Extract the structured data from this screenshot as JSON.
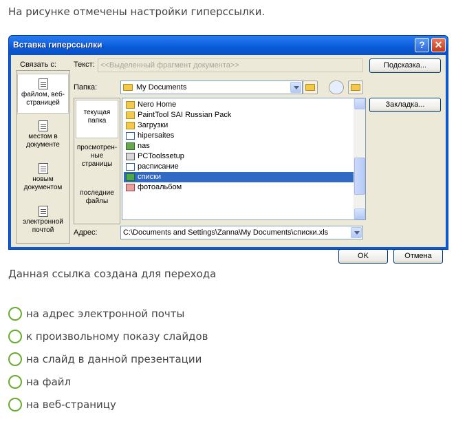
{
  "intro_text": "На рисунке отмечены настройки гиперссылки.",
  "dialog": {
    "title": "Вставка гиперссылки",
    "help_glyph": "?",
    "close_glyph": "✕",
    "link_to_label": "Связать с:",
    "text_label": "Текст:",
    "text_value": "<<Выделенный фрагмент документа>>",
    "tooltip_button": "Подсказка...",
    "folder_label": "Папка:",
    "folder_value": "My Documents",
    "bookmark_button": "Закладка...",
    "address_label": "Адрес:",
    "address_value": "C:\\Documents and Settings\\Zanna\\My Documents\\списки.xls",
    "ok_button": "OK",
    "cancel_button": "Отмена",
    "link_to_items": [
      {
        "label": "файлом, веб-страницей",
        "selected": true
      },
      {
        "label": "местом в документе",
        "selected": false
      },
      {
        "label": "новым документом",
        "selected": false
      },
      {
        "label": "электронной почтой",
        "selected": false
      }
    ],
    "nav_items": [
      {
        "label": "текущая папка",
        "selected": true
      },
      {
        "label": "просмотрен-ные страницы",
        "selected": false
      },
      {
        "label": "последние файлы",
        "selected": false
      }
    ],
    "files": [
      {
        "name": "Nero Home",
        "icon": "folder-icon",
        "selected": false
      },
      {
        "name": "PaintTool SAI Russian Pack",
        "icon": "folder-icon",
        "selected": false
      },
      {
        "name": "Загрузки",
        "icon": "folder-icon",
        "selected": false
      },
      {
        "name": "hipersaites",
        "icon": "word-doc-icon",
        "selected": false
      },
      {
        "name": "nas",
        "icon": "image-icon",
        "selected": false
      },
      {
        "name": "PCToolssetup",
        "icon": "app-icon",
        "selected": false
      },
      {
        "name": "расписание",
        "icon": "word-doc-icon",
        "selected": false
      },
      {
        "name": "списки",
        "icon": "excel-icon",
        "selected": true
      },
      {
        "name": "фотоальбом",
        "icon": "picture-icon",
        "selected": false
      }
    ]
  },
  "question": "Данная ссылка создана для перехода",
  "options": [
    "на адрес электронной почты",
    "к произвольному показу слайдов",
    "на слайд в данной презентации",
    "на файл",
    "на веб-страницу"
  ],
  "colors": {
    "title_bar": "#0a5ad8",
    "dialog_bg": "#ece9d8",
    "selection": "#316ac5",
    "radio_border": "#6aab2f"
  }
}
